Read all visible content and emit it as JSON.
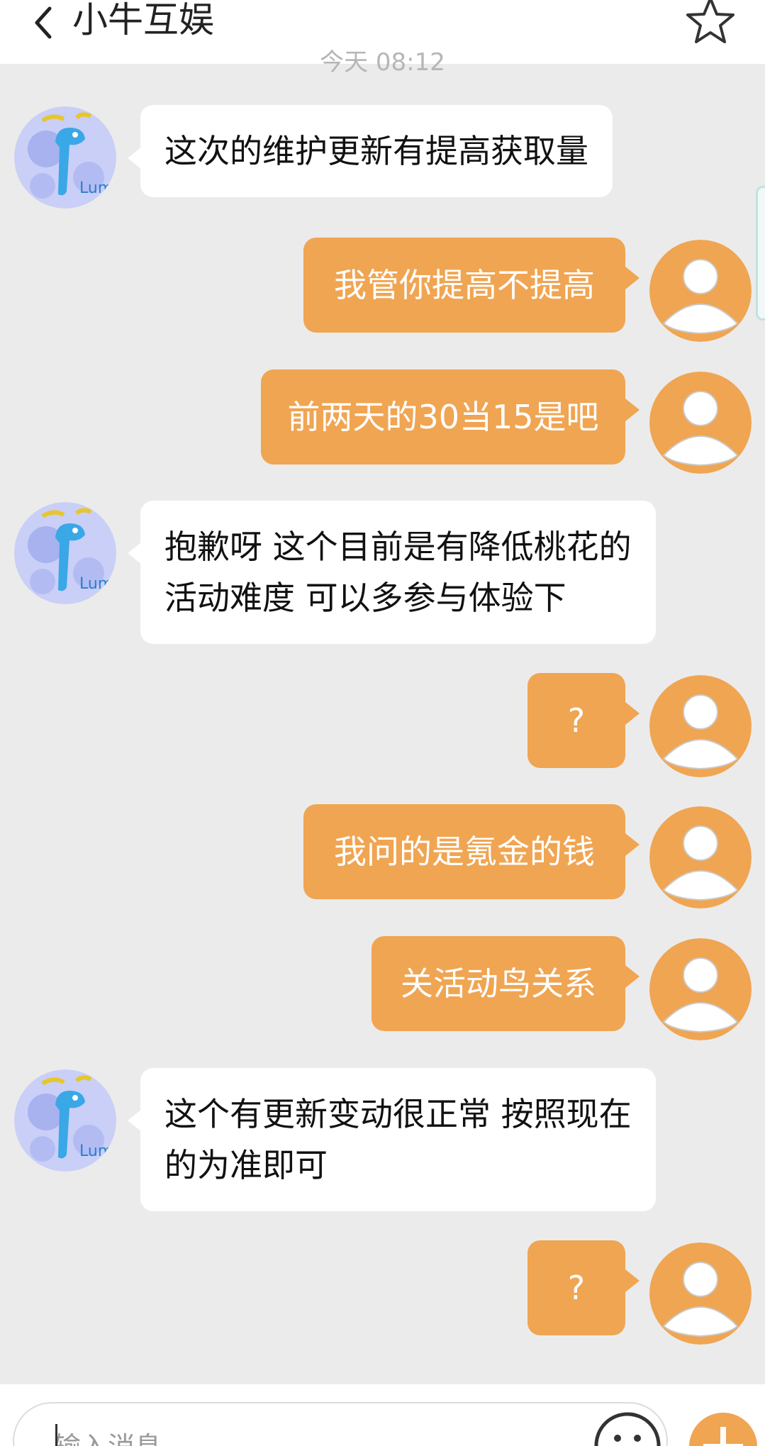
{
  "header": {
    "title": "小牛互娱",
    "back_icon": "chevron-left-icon",
    "favorite_icon": "star-outline-icon"
  },
  "time_divider": "今天 08:12",
  "colors": {
    "background": "#ebebeb",
    "incoming_bubble": "#ffffff",
    "outgoing_bubble": "#f0a552",
    "avatar_outgoing": "#f0a552"
  },
  "messages": [
    {
      "side": "left",
      "avatar": "support-agent-avatar",
      "text": "这次的维护更新有提高获取量"
    },
    {
      "side": "right",
      "avatar": "user-avatar",
      "text": "我管你提高不提高"
    },
    {
      "side": "right",
      "avatar": "user-avatar",
      "text": "前两天的30当15是吧"
    },
    {
      "side": "left",
      "avatar": "support-agent-avatar",
      "text": "抱歉呀 这个目前是有降低桃花的\n活动难度 可以多参与体验下"
    },
    {
      "side": "right",
      "avatar": "user-avatar",
      "text": "?"
    },
    {
      "side": "right",
      "avatar": "user-avatar",
      "text": "我问的是氪金的钱"
    },
    {
      "side": "right",
      "avatar": "user-avatar",
      "text": "关活动鸟关系"
    },
    {
      "side": "left",
      "avatar": "support-agent-avatar",
      "text": "这个有更新变动很正常 按照现在\n的为准即可"
    },
    {
      "side": "right",
      "avatar": "user-avatar",
      "text": "?"
    }
  ],
  "input": {
    "placeholder": "输入消息",
    "emoji_icon": "emoji-icon",
    "plus_icon": "plus-icon"
  }
}
